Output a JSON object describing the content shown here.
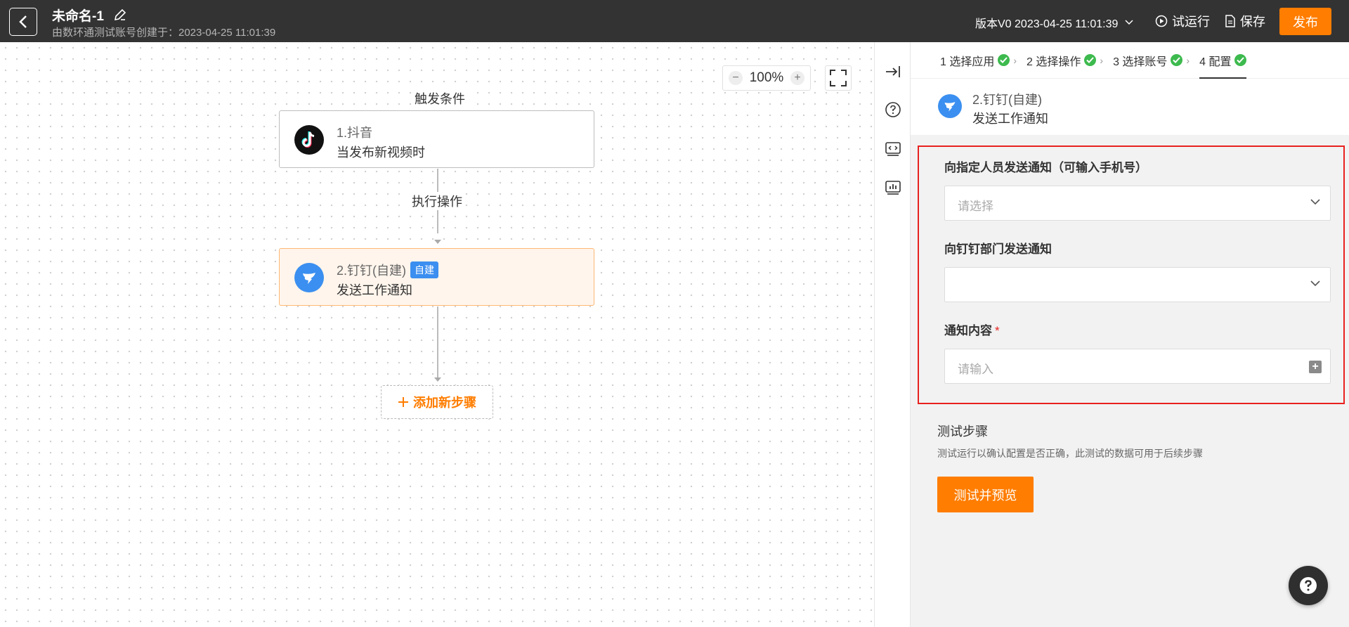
{
  "header": {
    "title": "未命名-1",
    "subtitle": "由数环通测试账号创建于：2023-04-25 11:01:39",
    "version": "版本V0 2023-04-25 11:01:39",
    "test_run": "试运行",
    "save": "保存",
    "publish": "发布",
    "accent_color": "#ff7d00"
  },
  "canvas": {
    "zoom": "100%",
    "trigger_label": "触发条件",
    "action_label": "执行操作",
    "trigger_node": {
      "title": "1.抖音",
      "subtitle": "当发布新视频时",
      "icon": "tiktok-icon"
    },
    "action_node": {
      "title": "2.钉钉(自建)",
      "tag": "自建",
      "subtitle": "发送工作通知",
      "icon": "dingtalk-icon"
    },
    "add_step": "添加新步骤"
  },
  "toolstrip": {
    "icons": [
      "collapse-panel-icon",
      "help-icon",
      "code-icon",
      "chart-icon"
    ]
  },
  "panel": {
    "steps": [
      {
        "label": "1 选择应用",
        "done": true
      },
      {
        "label": "2 选择操作",
        "done": true
      },
      {
        "label": "3 选择账号",
        "done": true
      },
      {
        "label": "4 配置",
        "done": true
      }
    ],
    "app_title": "2.钉钉(自建)",
    "app_action": "发送工作通知",
    "fields": {
      "user_label": "向指定人员发送通知（可输入手机号）",
      "user_placeholder": "请选择",
      "dept_label": "向钉钉部门发送通知",
      "dept_value": "",
      "content_label": "通知内容",
      "content_required": "*",
      "content_placeholder": "请输入"
    },
    "test_title": "测试步骤",
    "test_desc": "测试运行以确认配置是否正确，此测试的数据可用于后续步骤",
    "test_button": "测试并预览"
  }
}
